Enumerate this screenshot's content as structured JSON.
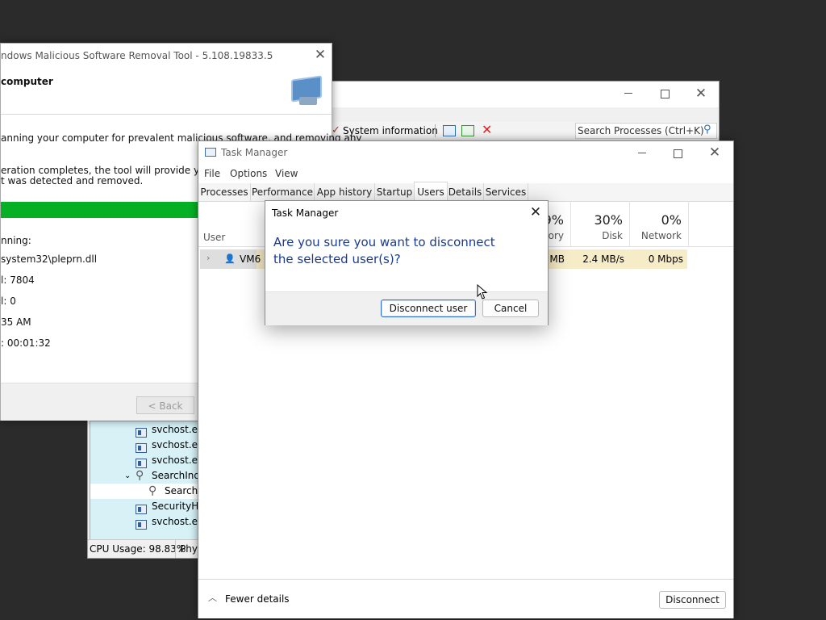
{
  "process_explorer": {
    "toolbar_sysinfo": "System information",
    "search_placeholder": "Search Processes (Ctrl+K)",
    "tree": [
      {
        "name": "svchost.exe",
        "indent": 0,
        "icon": "process-icon"
      },
      {
        "name": "svchost.exe",
        "indent": 0,
        "icon": "process-icon"
      },
      {
        "name": "svchost.exe",
        "indent": 0,
        "icon": "process-icon"
      },
      {
        "name": "SearchInde",
        "indent": 0,
        "icon": "search-icon",
        "expanded": true
      },
      {
        "name": "SearchP",
        "indent": 1,
        "icon": "search-icon",
        "selected": true
      },
      {
        "name": "SecurityHe",
        "indent": 0,
        "icon": "process-icon"
      },
      {
        "name": "svchost.exe",
        "indent": 0,
        "icon": "process-icon"
      }
    ],
    "status_cpu": "CPU Usage: 98.83%",
    "status_phys": "Phys"
  },
  "mrt": {
    "title": "ndows Malicious Software Removal Tool - 5.108.19833.5",
    "heading": "computer",
    "desc1a": "anning your computer for prevalent malicious software, and removing any",
    "desc2a": "eration completes, the tool will provide you with a re",
    "desc2b": "t was detected and removed.",
    "scanning_label": "nning:",
    "file": "system32\\pleprn.dll",
    "scanned": "l: 7804",
    "infected": "l: 0",
    "time": "35 AM",
    "elapsed": ": 00:01:32",
    "back": "< Back"
  },
  "task_manager": {
    "title": "Task Manager",
    "menu": [
      "File",
      "Options",
      "View"
    ],
    "tabs": [
      "Processes",
      "Performance",
      "App history",
      "Startup",
      "Users",
      "Details",
      "Services"
    ],
    "active_tab": "Users",
    "col_user": "User",
    "columns": [
      {
        "pct": "9%",
        "label": "nory"
      },
      {
        "pct": "30%",
        "label": "Disk"
      },
      {
        "pct": "0%",
        "label": "Network"
      }
    ],
    "row": {
      "user": "VM6 (",
      "memory": "MB",
      "disk": "2.4 MB/s",
      "network": "0 Mbps"
    },
    "fewer_details": "Fewer details",
    "disconnect": "Disconnect"
  },
  "dialog": {
    "title": "Task Manager",
    "message": "Are you sure you want to disconnect the selected user(s)?",
    "confirm": "Disconnect user",
    "cancel": "Cancel"
  }
}
